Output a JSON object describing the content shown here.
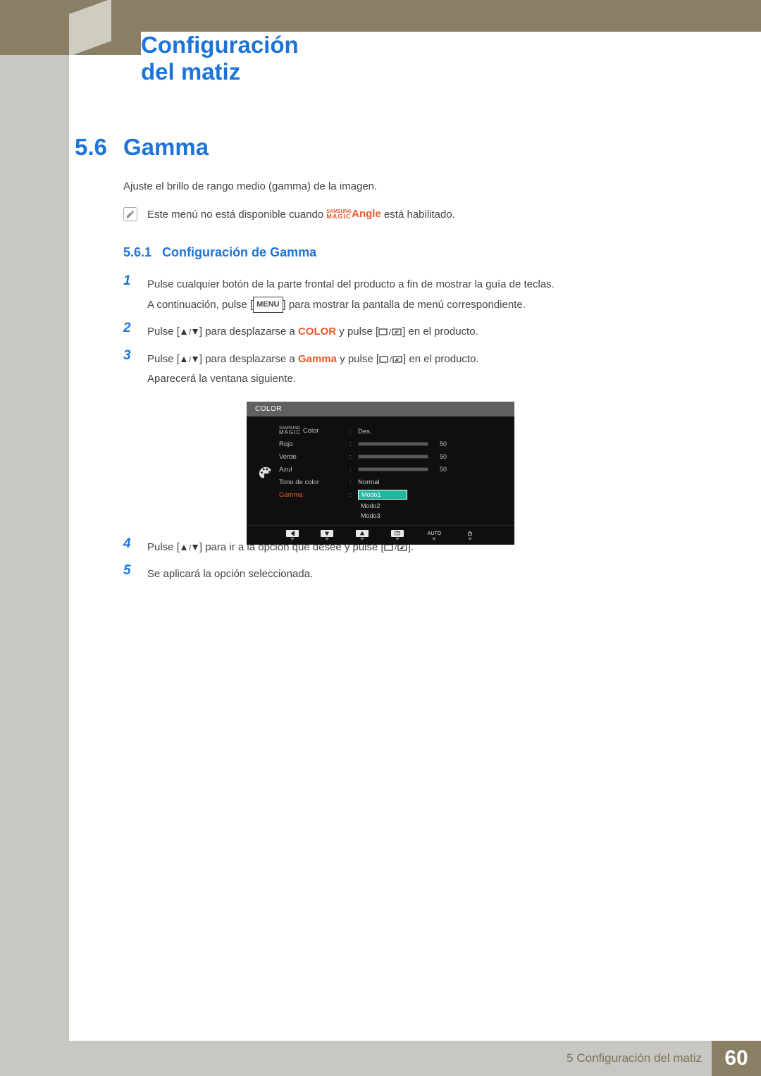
{
  "chapter_title": "Configuración del matiz",
  "section": {
    "number": "5.6",
    "title": "Gamma"
  },
  "intro": "Ajuste el brillo de rango medio (gamma) de la imagen.",
  "note": {
    "prefix": "Este menú no está disponible cuando ",
    "brand_top": "SAMSUNG",
    "brand_bot": "MAGIC",
    "angle": "Angle",
    "suffix": " está habilitado."
  },
  "subsection": {
    "number": "5.6.1",
    "title": "Configuración de Gamma"
  },
  "steps": {
    "s1_a": "Pulse cualquier botón de la parte frontal del producto a fin de mostrar la guía de teclas.",
    "s1_b_pre": "A continuación, pulse [",
    "s1_b_menu": "MENU",
    "s1_b_post": "] para mostrar la pantalla de menú correspondiente.",
    "s2_pre": "Pulse [",
    "s2_mid1": "] para desplazarse a ",
    "s2_color": "COLOR",
    "s2_mid2": " y pulse [",
    "s2_post": "] en el producto.",
    "s3_pre": "Pulse [",
    "s3_mid1": "] para desplazarse a ",
    "s3_gamma": "Gamma",
    "s3_mid2": " y pulse [",
    "s3_post": "] en el producto.",
    "s3_after": "Aparecerá la ventana siguiente.",
    "s4_pre": "Pulse [",
    "s4_mid": "] para ir a la opción que desee y pulse [",
    "s4_post": "].",
    "s5": "Se aplicará la opción seleccionada."
  },
  "osd": {
    "header": "COLOR",
    "magic_top": "SAMSUNG",
    "magic_bot": "MAGIC",
    "magic_color": " Color",
    "magic_value": "Des.",
    "rgb": [
      {
        "label": "Rojo",
        "value": 50
      },
      {
        "label": "Verde",
        "value": 50
      },
      {
        "label": "Azul",
        "value": 50
      }
    ],
    "tone_label": "Tono de color",
    "tone_value": "Normal",
    "gamma_label": "Gamma",
    "gamma_options": [
      "Modo1",
      "Modo2",
      "Modo3"
    ],
    "gamma_selected": "Modo1",
    "footer_auto": "AUTO"
  },
  "footer": {
    "chapter": "5 Configuración del matiz",
    "page": "60"
  },
  "nums": {
    "n1": "1",
    "n2": "2",
    "n3": "3",
    "n4": "4",
    "n5": "5"
  }
}
